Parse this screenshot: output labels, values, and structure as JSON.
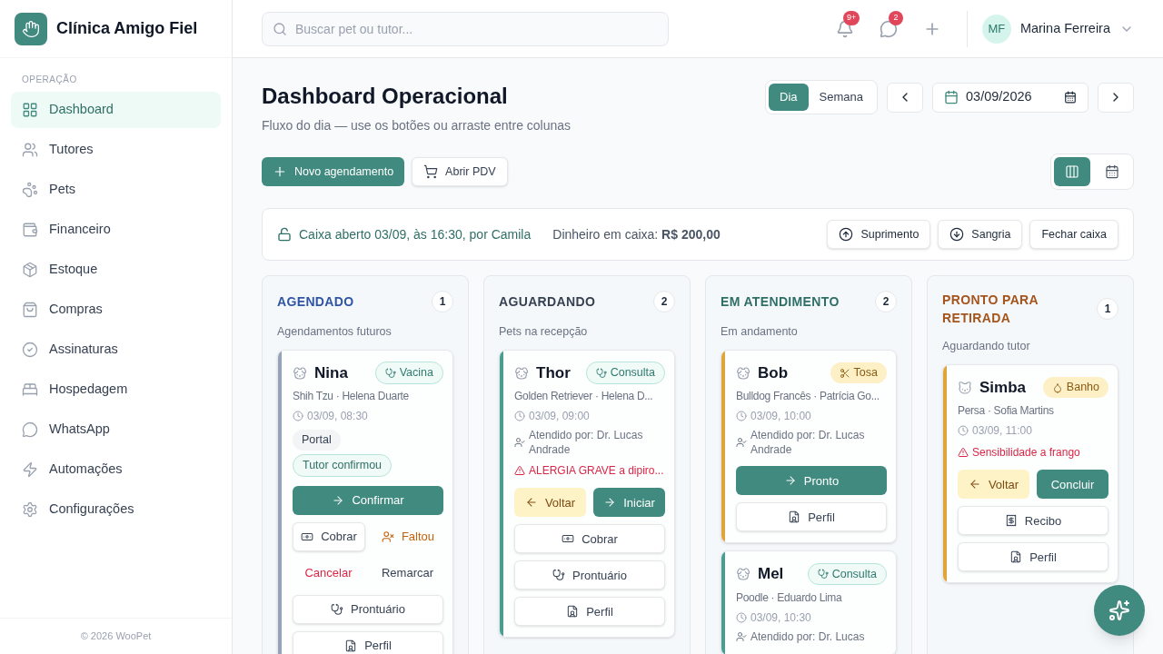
{
  "brand": {
    "name": "Clínica Amigo Fiel"
  },
  "sidebar": {
    "section": "OPERAÇÃO",
    "items": [
      {
        "label": "Dashboard",
        "selected": true
      },
      {
        "label": "Tutores",
        "selected": false
      },
      {
        "label": "Pets",
        "selected": false
      },
      {
        "label": "Financeiro",
        "selected": false
      },
      {
        "label": "Estoque",
        "selected": false
      },
      {
        "label": "Compras",
        "selected": false
      },
      {
        "label": "Assinaturas",
        "selected": false
      },
      {
        "label": "Hospedagem",
        "selected": false
      },
      {
        "label": "WhatsApp",
        "selected": false
      },
      {
        "label": "Automações",
        "selected": false
      },
      {
        "label": "Configurações",
        "selected": false
      }
    ],
    "footer": "© 2026 WooPet"
  },
  "topbar": {
    "search": {
      "placeholder": "Buscar pet ou tutor..."
    },
    "notifications": "9+",
    "messages": "2",
    "user": {
      "initials": "MF",
      "name": "Marina Ferreira"
    }
  },
  "page": {
    "title": "Dashboard Operacional",
    "subtitle": "Fluxo do dia — use os botões ou arraste entre colunas",
    "range": [
      {
        "label": "Dia",
        "selected": true
      },
      {
        "label": "Semana",
        "selected": false
      }
    ],
    "date": "03/09/2026",
    "actions": [
      "Novo agendamento",
      "Abrir PDV"
    ],
    "views": [
      {
        "selected": true
      },
      {
        "selected": false
      }
    ]
  },
  "cash": {
    "status": "Caixa aberto 03/09, às 16:30, por Camila",
    "balance": "Dinheiro em caixa: **R$ 200,00**",
    "buttons": [
      "Suprimento",
      "Sangria",
      "Fechar caixa"
    ]
  },
  "columns": [
    {
      "title": "AGENDADO",
      "count": "1",
      "subtitle": "Agendamentos futuros",
      "color": "#2f55a4",
      "cards": [
        {
          "name": "Nina",
          "kind": "dog",
          "color": "#94a3b8",
          "service": {
            "label": "Vacina",
            "kind": "clinical"
          },
          "meta": "Shih Tzu · Helena Duarte",
          "time": "03/09, 08:30",
          "tags": [
            {
              "label": "Portal",
              "kind": "neutral"
            },
            {
              "label": "Tutor confirmou",
              "kind": "positive"
            }
          ],
          "action_rows": [
            [
              {
                "label": "Confirmar",
                "kind": "advance"
              }
            ],
            [
              {
                "label": "Cobrar",
                "kind": "charge"
              },
              {
                "label": "Faltou",
                "kind": "no_show"
              }
            ],
            [
              {
                "label": "Cancelar",
                "kind": "cancel"
              },
              {
                "label": "Remarcar",
                "kind": "reschedule"
              }
            ],
            [
              {
                "label": "Prontuário",
                "kind": "record"
              }
            ],
            [
              {
                "label": "Perfil",
                "kind": "profile"
              }
            ]
          ]
        }
      ]
    },
    {
      "title": "AGUARDANDO",
      "count": "2",
      "subtitle": "Pets na recepção",
      "color": "#374151",
      "cards": [
        {
          "name": "Thor",
          "kind": "dog",
          "color": "#4a9d8f",
          "service": {
            "label": "Consulta",
            "kind": "clinical"
          },
          "meta": "Golden Retriever · Helena D...",
          "time": "03/09, 09:00",
          "attended_by": "Atendido por: Dr. Lucas Andrade",
          "alert": "ALERGIA GRAVE a dipiro...",
          "action_rows": [
            [
              {
                "label": "Voltar",
                "kind": "back"
              },
              {
                "label": "Iniciar",
                "kind": "advance"
              }
            ],
            [
              {
                "label": "Cobrar",
                "kind": "charge"
              }
            ],
            [
              {
                "label": "Prontuário",
                "kind": "record"
              }
            ],
            [
              {
                "label": "Perfil",
                "kind": "profile"
              }
            ]
          ]
        }
      ]
    },
    {
      "title": "EM ATENDIMENTO",
      "count": "2",
      "subtitle": "Em andamento",
      "color": "#2f6f66",
      "cards": [
        {
          "name": "Bob",
          "kind": "dog",
          "color": "#e0a53a",
          "service": {
            "label": "Tosa",
            "kind": "grooming"
          },
          "meta": "Bulldog Francês · Patrícia Go...",
          "time": "03/09, 10:00",
          "attended_by": "Atendido por: Dr. Lucas Andrade",
          "action_rows": [
            [
              {
                "label": "Pronto",
                "kind": "advance"
              }
            ],
            [
              {
                "label": "Perfil",
                "kind": "profile"
              }
            ]
          ]
        },
        {
          "name": "Mel",
          "kind": "dog",
          "color": "#4a9d8f",
          "service": {
            "label": "Consulta",
            "kind": "clinical"
          },
          "meta": "Poodle · Eduardo Lima",
          "time": "03/09, 10:30",
          "attended_by": "Atendido por: Dr. Lucas"
        }
      ]
    },
    {
      "title": "PRONTO PARA RETIRADA",
      "count": "1",
      "subtitle": "Aguardando tutor",
      "color": "#a5541c",
      "cards": [
        {
          "name": "Simba",
          "kind": "cat",
          "color": "#e0a53a",
          "service": {
            "label": "Banho",
            "kind": "bath"
          },
          "meta": "Persa · Sofia Martins",
          "time": "03/09, 11:00",
          "alert": "Sensibilidade a frango",
          "action_rows": [
            [
              {
                "label": "Voltar",
                "kind": "back"
              },
              {
                "label": "Concluir",
                "kind": "complete"
              }
            ],
            [
              {
                "label": "Recibo",
                "kind": "receipt"
              }
            ],
            [
              {
                "label": "Perfil",
                "kind": "profile"
              }
            ]
          ]
        }
      ]
    }
  ]
}
